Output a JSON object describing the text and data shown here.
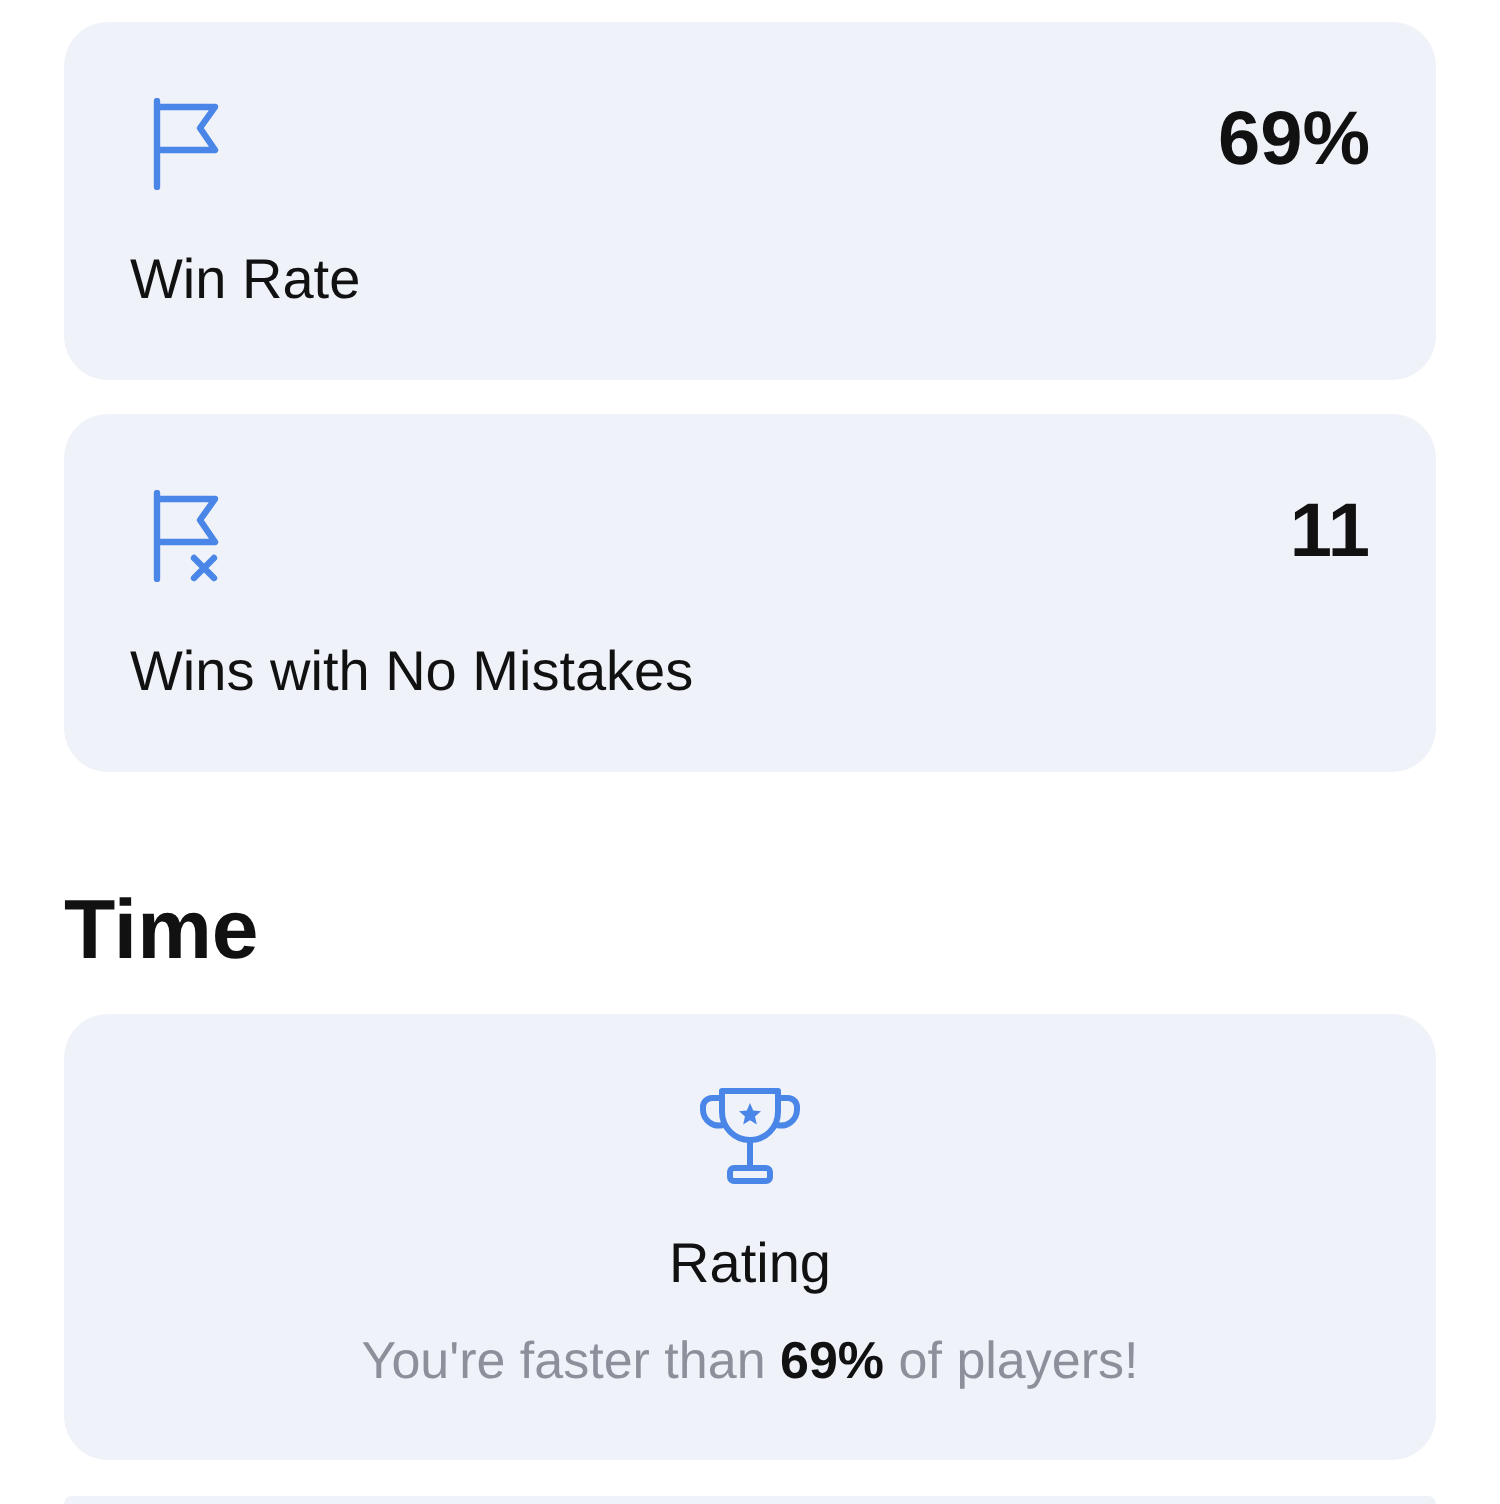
{
  "stats": [
    {
      "kind": "win_rate",
      "label": "Win Rate",
      "value": "69%"
    },
    {
      "kind": "no_mistakes",
      "label": "Wins with No Mistakes",
      "value": "11"
    }
  ],
  "time": {
    "heading": "Time",
    "rating": {
      "title": "Rating",
      "text": "You're faster than **69%** of players!"
    }
  }
}
